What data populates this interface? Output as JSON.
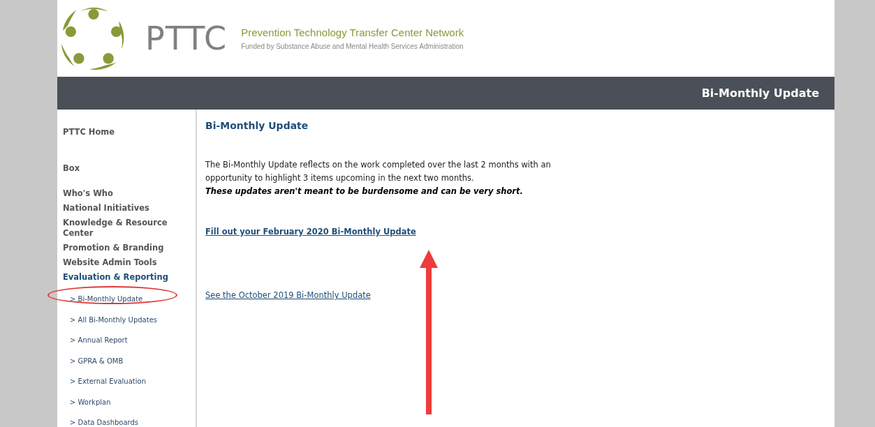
{
  "header": {
    "logo_text": "PTTC",
    "title": "Prevention Technology Transfer Center Network",
    "subtitle": "Funded by Substance Abuse and Mental Health Services Administration"
  },
  "banner": {
    "title": "Bi-Monthly Update"
  },
  "sidebar": {
    "items": [
      {
        "label": "PTTC Home",
        "selected": false
      },
      {
        "label": "Box",
        "selected": false
      },
      {
        "label": "Who's Who",
        "selected": false
      },
      {
        "label": "National Initiatives",
        "selected": false
      },
      {
        "label": "Knowledge & Resource Center",
        "selected": false
      },
      {
        "label": "Promotion & Branding",
        "selected": false
      },
      {
        "label": "Website Admin Tools",
        "selected": false
      },
      {
        "label": "Evaluation & Reporting",
        "selected": true,
        "children": [
          {
            "label": "> Bi-Monthly Update",
            "circled": true
          },
          {
            "label": "> All Bi-Monthly Updates",
            "circled": false
          },
          {
            "label": "> Annual Report",
            "circled": false
          },
          {
            "label": "> GPRA & OMB",
            "circled": false
          },
          {
            "label": "> External Evaluation",
            "circled": false
          },
          {
            "label": "> Workplan",
            "circled": false
          },
          {
            "label": "> Data Dashboards",
            "circled": false
          }
        ]
      }
    ]
  },
  "content": {
    "heading": "Bi-Monthly Update",
    "intro": "The Bi-Monthly Update reflects on the work completed over the last 2 months with an opportunity to highlight 3 items upcoming in the next two months.",
    "note": "These updates aren't meant to be burdensome and can be very short.",
    "primary_link": "Fill out your February 2020 Bi-Monthly Update",
    "secondary_link": "See the October 2019 Bi-Monthly Update"
  }
}
